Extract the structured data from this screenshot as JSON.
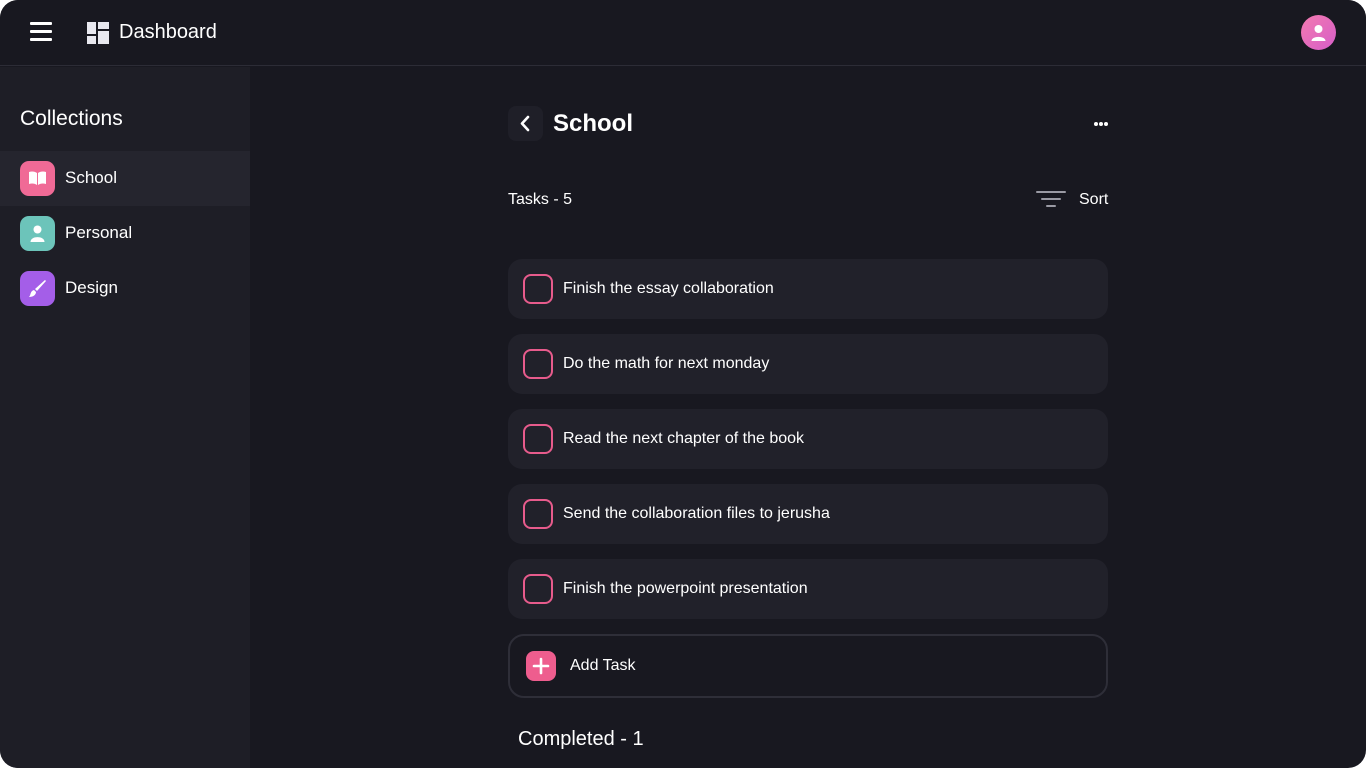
{
  "header": {
    "title": "Dashboard",
    "menu_icon": "hamburger-menu-icon",
    "dashboard_icon": "dashboard-grid-icon",
    "avatar_icon": "user-icon"
  },
  "sidebar": {
    "title": "Collections",
    "items": [
      {
        "label": "School",
        "icon": "book-icon",
        "color": "#f06a96",
        "active": true
      },
      {
        "label": "Personal",
        "icon": "person-icon",
        "color": "#6cc4ba",
        "active": false
      },
      {
        "label": "Design",
        "icon": "brush-icon",
        "color": "#a45ee8",
        "active": false
      }
    ]
  },
  "main": {
    "title": "School",
    "back_icon": "chevron-left-icon",
    "more_icon": "more-horizontal-icon",
    "tasks_count": "Tasks - 5",
    "sort_label": "Sort",
    "sort_icon": "sort-icon",
    "tasks": [
      {
        "label": "Finish the essay collaboration",
        "done": false
      },
      {
        "label": "Do the math for next monday",
        "done": false
      },
      {
        "label": "Read the next chapter of the book",
        "done": false
      },
      {
        "label": "Send the collaboration files to jerusha",
        "done": false
      },
      {
        "label": "Finish the powerpoint presentation",
        "done": false
      }
    ],
    "add_task_label": "Add Task",
    "add_icon": "plus-icon",
    "completed_count": "Completed - 1"
  },
  "colors": {
    "background": "#181820",
    "sidebar": "#1e1e26",
    "card": "#21212a",
    "accent": "#ee5d8e"
  }
}
